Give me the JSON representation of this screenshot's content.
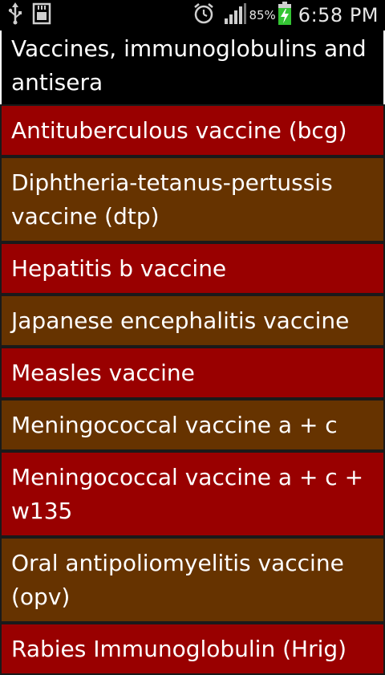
{
  "status_bar": {
    "left_icons": [
      "usb-icon",
      "sd-card-icon"
    ],
    "right_icons": [
      "alarm-icon",
      "signal-icon",
      "battery-charging-icon"
    ],
    "battery_percent": "85%",
    "time": "6:58 PM"
  },
  "header": {
    "title": "Vaccines, immunoglobulins and antisera"
  },
  "list": {
    "colors": {
      "red": "#990000",
      "brown": "#663300"
    },
    "items": [
      {
        "label": "Antituberculous vaccine (bcg)"
      },
      {
        "label": "Diphtheria-tetanus-pertussis vaccine (dtp)"
      },
      {
        "label": "Hepatitis b vaccine"
      },
      {
        "label": "Japanese encephalitis vaccine"
      },
      {
        "label": "Measles vaccine"
      },
      {
        "label": "Meningococcal vaccine a + c"
      },
      {
        "label": "Meningococcal vaccine a + c + w135"
      },
      {
        "label": "Oral antipoliomyelitis vaccine (opv)"
      },
      {
        "label": "Rabies Immunoglobulin (Hrig)"
      }
    ]
  }
}
